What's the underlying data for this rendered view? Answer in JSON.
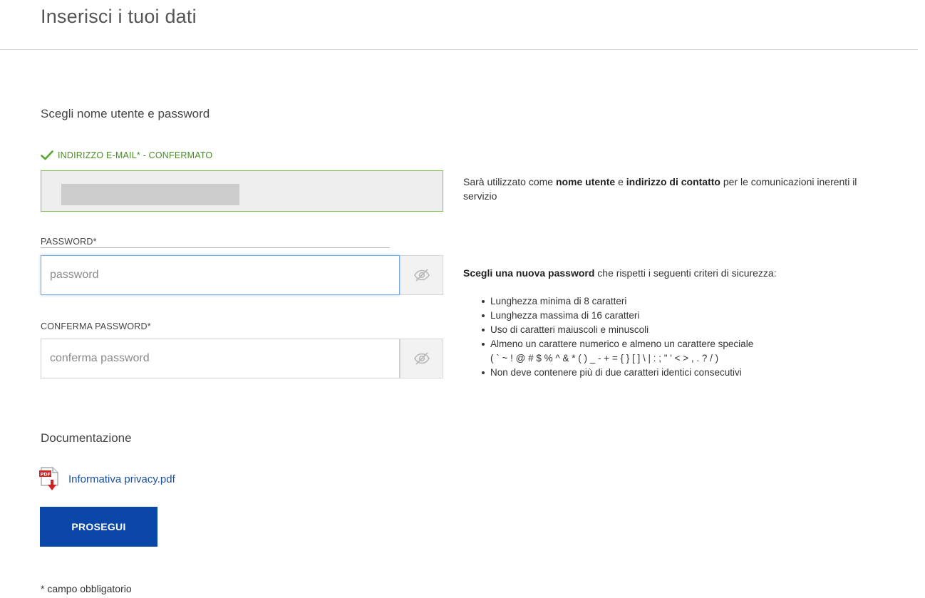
{
  "page": {
    "title": "Inserisci i tuoi dati"
  },
  "credentials": {
    "section_title": "Scegli nome utente e password",
    "email": {
      "label": "INDIRIZZO E-MAIL* - CONFERMATO",
      "status_color": "#4a8a2a",
      "help_pre": "Sarà utilizzato come ",
      "help_bold1": "nome utente",
      "help_mid": " e ",
      "help_bold2": "indirizzo di contatto",
      "help_post": " per le comunicazioni inerenti il servizio"
    },
    "password": {
      "label": "PASSWORD*",
      "placeholder": "password",
      "toggle_icon": "eye-slash-icon"
    },
    "confirm_password": {
      "label": "CONFERMA PASSWORD*",
      "placeholder": "conferma password",
      "toggle_icon": "eye-slash-icon"
    },
    "password_help": {
      "bold": "Scegli una nuova password",
      "rest": " che rispetti i seguenti criteri di sicurezza:",
      "criteria": [
        "Lunghezza minima di 8 caratteri",
        "Lunghezza massima di 16 caratteri",
        "Uso di caratteri maiuscoli e minuscoli",
        "Almeno un carattere numerico e almeno un carattere speciale",
        "Non deve contenere più di due caratteri identici consecutivi"
      ],
      "special_chars": "( ` ~ ! @ # $ % ^ & * ( ) _ - + = { } [ ] \\ | : ; \" ' < > , . ? / )"
    }
  },
  "documentation": {
    "section_title": "Documentazione",
    "pdf_icon": "pdf-download-icon",
    "link_label": "Informativa privacy.pdf",
    "link_color": "#1a4fa0"
  },
  "actions": {
    "submit_label": "PROSEGUI",
    "submit_color": "#0b47a8"
  },
  "footnote": "* campo obbligatorio"
}
